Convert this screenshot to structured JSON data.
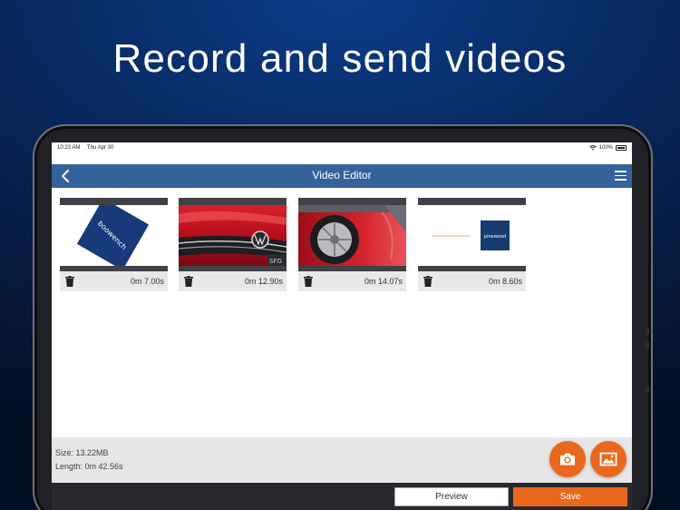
{
  "headline": "Record and send videos",
  "status_bar": {
    "time": "10:23 AM",
    "date": "Thu Apr 30",
    "battery": "100%"
  },
  "nav": {
    "title": "Video Editor"
  },
  "clips": [
    {
      "duration": "0m 7.00s",
      "thumbnail": "boowench-logo",
      "logo_text": "boowench"
    },
    {
      "duration": "0m 12.90s",
      "thumbnail": "red-car-grille"
    },
    {
      "duration": "0m 14.07s",
      "thumbnail": "red-car-wheel"
    },
    {
      "duration": "0m 8.60s",
      "thumbnail": "pinewood-logo",
      "logo_text": "pinewood"
    }
  ],
  "summary": {
    "size": "Size: 13.22MB",
    "length": "Length: 0m 42.56s"
  },
  "actions": {
    "preview_label": "Preview",
    "save_label": "Save"
  },
  "colors": {
    "nav": "#34629b",
    "accent": "#e9681e",
    "clip_bar": "#404146",
    "logo_navy": "#163a7a"
  }
}
